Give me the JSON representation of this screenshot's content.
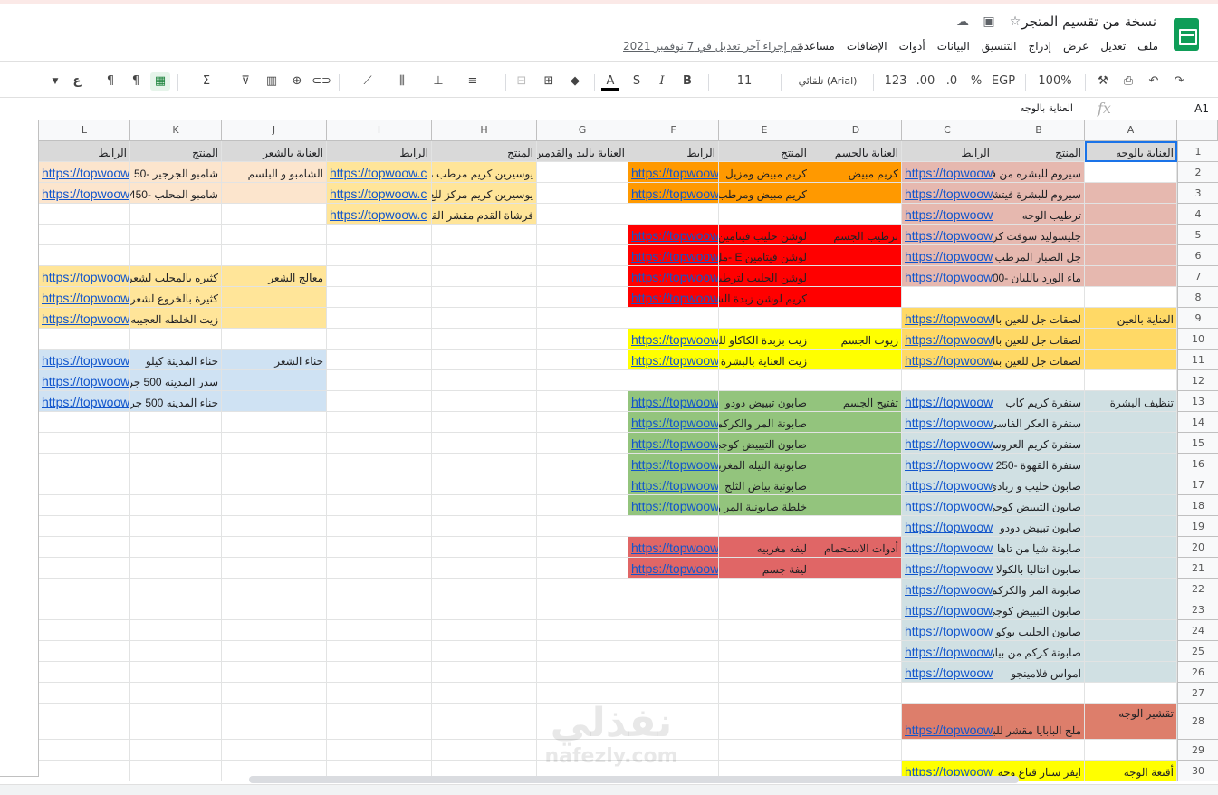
{
  "document": {
    "title": "نسخة من تقسيم المتجر",
    "last_edit": "تم إجراء آخر تعديل في 7 نوفمبر 2021"
  },
  "menu": [
    "ملف",
    "تعديل",
    "عرض",
    "إدراج",
    "التنسيق",
    "البيانات",
    "أدوات",
    "الإضافات",
    "مساعدة"
  ],
  "toolbar": {
    "zoom": "100%",
    "currency": "EGP",
    "percent": "%",
    "dec_decrease": ".0",
    "dec_increase": ".00",
    "format_123": "123",
    "font": "تلقائي (Arial)",
    "font_size": "11",
    "bold": "B",
    "italic": "I",
    "strike": "S",
    "text_color": "A"
  },
  "formula_bar": {
    "name_box": "A1",
    "fx": "fx",
    "value": "العناية بالوجه"
  },
  "columns": [
    "A",
    "B",
    "C",
    "D",
    "E",
    "F",
    "G",
    "H",
    "I",
    "J",
    "K",
    "L"
  ],
  "rows": [
    "1",
    "2",
    "3",
    "4",
    "5",
    "6",
    "7",
    "8",
    "9",
    "10",
    "11",
    "12",
    "13",
    "14",
    "15",
    "16",
    "17",
    "18",
    "19",
    "20",
    "21",
    "22",
    "23",
    "24",
    "25",
    "26",
    "27",
    "28",
    "29",
    "30"
  ],
  "colors": {
    "pink": "#e6b8af",
    "orange": "#ff9900",
    "red": "#ff0000",
    "lightorange": "#fce5cd",
    "yellowlight": "#ffe599",
    "yellow": "#ffff00",
    "blue": "#cfe2f3",
    "green": "#93c47d",
    "teal": "#d0e0e3",
    "salmon": "#e06666",
    "darksalmon": "#dd7e6b",
    "gold": "#ffd966",
    "header": "#d9d9d9",
    "selected": "#e8f0fe"
  },
  "link_text": "https://topwoow",
  "cells": [
    {
      "r": 1,
      "c": "A",
      "v": "العناية بالوجه",
      "bg": "#d9d9d9"
    },
    {
      "r": 1,
      "c": "B",
      "v": "المنتج",
      "bg": "#d9d9d9"
    },
    {
      "r": 1,
      "c": "C",
      "v": "الرابط",
      "bg": "#d9d9d9"
    },
    {
      "r": 1,
      "c": "D",
      "v": "العناية بالجسم",
      "bg": "#d9d9d9"
    },
    {
      "r": 1,
      "c": "E",
      "v": "المنتج",
      "bg": "#d9d9d9"
    },
    {
      "r": 1,
      "c": "F",
      "v": "الرابط",
      "bg": "#d9d9d9"
    },
    {
      "r": 1,
      "c": "G",
      "v": "العناية باليد والقدمين",
      "bg": "#d9d9d9"
    },
    {
      "r": 1,
      "c": "H",
      "v": "المنتج",
      "bg": "#d9d9d9"
    },
    {
      "r": 1,
      "c": "I",
      "v": "الرابط",
      "bg": "#d9d9d9"
    },
    {
      "r": 1,
      "c": "J",
      "v": "العناية بالشعر",
      "bg": "#d9d9d9"
    },
    {
      "r": 1,
      "c": "K",
      "v": "المنتج",
      "bg": "#d9d9d9"
    },
    {
      "r": 1,
      "c": "L",
      "v": "الرابط",
      "bg": "#d9d9d9"
    },
    {
      "r": 2,
      "c": "A",
      "v": "",
      "bg": "#ffffff"
    },
    {
      "r": 2,
      "c": "B",
      "v": "سيروم للبشره من فيتا",
      "bg": "#e6b8af"
    },
    {
      "r": 2,
      "c": "C",
      "v": "https://topwoow",
      "bg": "#e6b8af",
      "link": true
    },
    {
      "r": 2,
      "c": "D",
      "v": "كريم مبيض",
      "bg": "#ff9900"
    },
    {
      "r": 2,
      "c": "E",
      "v": "كريم مبيض ومزيل",
      "bg": "#ff9900"
    },
    {
      "r": 2,
      "c": "F",
      "v": "https://topwoow",
      "bg": "#ff9900",
      "link": true
    },
    {
      "r": 2,
      "c": "H",
      "v": "يوسيرين كريم مرطب من",
      "bg": "#ffe599"
    },
    {
      "r": 2,
      "c": "I",
      "v": "https://topwoow.c",
      "bg": "#ffe599",
      "link": true
    },
    {
      "r": 2,
      "c": "J",
      "v": "الشامبو و البلسم",
      "bg": "#fce5cd"
    },
    {
      "r": 2,
      "c": "K",
      "v": "شامبو الجرجير -50",
      "bg": "#fce5cd"
    },
    {
      "r": 2,
      "c": "L",
      "v": "https://topwoow",
      "bg": "#fce5cd",
      "link": true
    },
    {
      "r": 3,
      "c": "A",
      "v": "",
      "bg": "#e6b8af"
    },
    {
      "r": 3,
      "c": "B",
      "v": "سيروم للبشرة فيتشي",
      "bg": "#e6b8af"
    },
    {
      "r": 3,
      "c": "C",
      "v": "https://topwoow",
      "bg": "#e6b8af",
      "link": true
    },
    {
      "r": 3,
      "c": "D",
      "v": "",
      "bg": "#ff9900"
    },
    {
      "r": 3,
      "c": "E",
      "v": "كريم مبيض ومرطب",
      "bg": "#ff9900"
    },
    {
      "r": 3,
      "c": "F",
      "v": "https://topwoow",
      "bg": "#ff9900",
      "link": true
    },
    {
      "r": 3,
      "c": "H",
      "v": "يوسيرين كريم مركز للع",
      "bg": "#ffe599"
    },
    {
      "r": 3,
      "c": "I",
      "v": "https://topwoow.c",
      "bg": "#ffe599",
      "link": true
    },
    {
      "r": 3,
      "c": "J",
      "v": "",
      "bg": "#fce5cd"
    },
    {
      "r": 3,
      "c": "K",
      "v": "شامبو المحلب -450",
      "bg": "#fce5cd"
    },
    {
      "r": 3,
      "c": "L",
      "v": "https://topwoow",
      "bg": "#fce5cd",
      "link": true
    },
    {
      "r": 4,
      "c": "A",
      "v": "",
      "bg": "#e6b8af"
    },
    {
      "r": 4,
      "c": "B",
      "v": "ترطيب الوجه",
      "bg": "#e6b8af"
    },
    {
      "r": 4,
      "c": "C",
      "v": "https://topwoow",
      "bg": "#e6b8af",
      "link": true
    },
    {
      "r": 4,
      "c": "H",
      "v": "فرشاة القدم مقشر القدم",
      "bg": "#ffe599"
    },
    {
      "r": 4,
      "c": "I",
      "v": "https://topwoow.c",
      "bg": "#ffe599",
      "link": true
    },
    {
      "r": 5,
      "c": "A",
      "v": "",
      "bg": "#e6b8af"
    },
    {
      "r": 5,
      "c": "B",
      "v": "جليسوليد سوفت كريم",
      "bg": "#e6b8af"
    },
    {
      "r": 5,
      "c": "C",
      "v": "https://topwoow",
      "bg": "#e6b8af",
      "link": true
    },
    {
      "r": 5,
      "c": "D",
      "v": "ترطيب الجسم",
      "bg": "#ff0000"
    },
    {
      "r": 5,
      "c": "E",
      "v": "لوشن حليب فيتامين",
      "bg": "#ff0000"
    },
    {
      "r": 5,
      "c": "F",
      "v": "https://topwoow",
      "bg": "#ff0000",
      "link": true
    },
    {
      "r": 6,
      "c": "A",
      "v": "",
      "bg": "#e6b8af"
    },
    {
      "r": 6,
      "c": "B",
      "v": "جل الصبار المرطب",
      "bg": "#e6b8af"
    },
    {
      "r": 6,
      "c": "C",
      "v": "https://topwoow",
      "bg": "#e6b8af",
      "link": true
    },
    {
      "r": 6,
      "c": "D",
      "v": "",
      "bg": "#ff0000"
    },
    {
      "r": 6,
      "c": "E",
      "v": "لوشن فيتامين E -مل",
      "bg": "#ff0000"
    },
    {
      "r": 6,
      "c": "F",
      "v": "https://topwoow",
      "bg": "#ff0000",
      "link": true
    },
    {
      "r": 7,
      "c": "A",
      "v": "",
      "bg": "#e6b8af"
    },
    {
      "r": 7,
      "c": "B",
      "v": "ماء الورد باللبان -00",
      "bg": "#e6b8af"
    },
    {
      "r": 7,
      "c": "C",
      "v": "https://topwoow",
      "bg": "#e6b8af",
      "link": true
    },
    {
      "r": 7,
      "c": "D",
      "v": "",
      "bg": "#ff0000"
    },
    {
      "r": 7,
      "c": "E",
      "v": "لوشن الحليب لترطيب",
      "bg": "#ff0000"
    },
    {
      "r": 7,
      "c": "F",
      "v": "https://topwoow",
      "bg": "#ff0000",
      "link": true
    },
    {
      "r": 7,
      "c": "J",
      "v": "معالج الشعر",
      "bg": "#ffe599"
    },
    {
      "r": 7,
      "c": "K",
      "v": "كثيره بالمحلب لشعر",
      "bg": "#ffe599"
    },
    {
      "r": 7,
      "c": "L",
      "v": "https://topwoow",
      "bg": "#ffe599",
      "link": true
    },
    {
      "r": 8,
      "c": "D",
      "v": "",
      "bg": "#ff0000"
    },
    {
      "r": 8,
      "c": "E",
      "v": "كريم لوشن زبدة الشيا",
      "bg": "#ff0000"
    },
    {
      "r": 8,
      "c": "F",
      "v": "https://topwoow",
      "bg": "#ff0000",
      "link": true
    },
    {
      "r": 8,
      "c": "J",
      "v": "",
      "bg": "#ffe599"
    },
    {
      "r": 8,
      "c": "K",
      "v": "كثيرة بالخروع لشعر",
      "bg": "#ffe599"
    },
    {
      "r": 8,
      "c": "L",
      "v": "https://topwoow",
      "bg": "#ffe599",
      "link": true
    },
    {
      "r": 9,
      "c": "A",
      "v": "العناية بالعين",
      "bg": "#ffd966"
    },
    {
      "r": 9,
      "c": "B",
      "v": "لصقات جل للعين بال",
      "bg": "#ffd966"
    },
    {
      "r": 9,
      "c": "C",
      "v": "https://topwoow",
      "bg": "#ffd966",
      "link": true
    },
    {
      "r": 9,
      "c": "J",
      "v": "",
      "bg": "#ffe599"
    },
    {
      "r": 9,
      "c": "K",
      "v": "زيت الخلطه العجيبه",
      "bg": "#ffe599"
    },
    {
      "r": 9,
      "c": "L",
      "v": "https://topwoow",
      "bg": "#ffe599",
      "link": true
    },
    {
      "r": 10,
      "c": "A",
      "v": "",
      "bg": "#ffd966"
    },
    {
      "r": 10,
      "c": "B",
      "v": "لصقات جل للعين بال",
      "bg": "#ffd966"
    },
    {
      "r": 10,
      "c": "C",
      "v": "https://topwoow",
      "bg": "#ffd966",
      "link": true
    },
    {
      "r": 10,
      "c": "D",
      "v": "زيوت الجسم",
      "bg": "#ffff00"
    },
    {
      "r": 10,
      "c": "E",
      "v": "زيت بزبدة الكاكاو للج",
      "bg": "#ffff00"
    },
    {
      "r": 10,
      "c": "F",
      "v": "https://topwoow",
      "bg": "#ffff00",
      "link": true
    },
    {
      "r": 11,
      "c": "A",
      "v": "",
      "bg": "#ffd966"
    },
    {
      "r": 11,
      "c": "B",
      "v": "لصقات جل للعين بش",
      "bg": "#ffd966"
    },
    {
      "r": 11,
      "c": "C",
      "v": "https://topwoow",
      "bg": "#ffd966",
      "link": true
    },
    {
      "r": 11,
      "c": "D",
      "v": "",
      "bg": "#ffff00"
    },
    {
      "r": 11,
      "c": "E",
      "v": "زيت العناية بالبشرة",
      "bg": "#ffff00"
    },
    {
      "r": 11,
      "c": "F",
      "v": "https://topwoow",
      "bg": "#ffff00",
      "link": true
    },
    {
      "r": 11,
      "c": "J",
      "v": "حناء الشعر",
      "bg": "#cfe2f3"
    },
    {
      "r": 11,
      "c": "K",
      "v": "حناء المدينة كيلو",
      "bg": "#cfe2f3"
    },
    {
      "r": 11,
      "c": "L",
      "v": "https://topwoow",
      "bg": "#cfe2f3",
      "link": true
    },
    {
      "r": 12,
      "c": "J",
      "v": "",
      "bg": "#cfe2f3"
    },
    {
      "r": 12,
      "c": "K",
      "v": "سدر المدينه 500 جر",
      "bg": "#cfe2f3"
    },
    {
      "r": 12,
      "c": "L",
      "v": "https://topwoow",
      "bg": "#cfe2f3",
      "link": true
    },
    {
      "r": 13,
      "c": "A",
      "v": "تنظيف البشرة",
      "bg": "#d0e0e3"
    },
    {
      "r": 13,
      "c": "B",
      "v": "سنفرة كريم كاب",
      "bg": "#d0e0e3"
    },
    {
      "r": 13,
      "c": "C",
      "v": "https://topwoow",
      "bg": "#d0e0e3",
      "link": true
    },
    {
      "r": 13,
      "c": "D",
      "v": "تفتيح الجسم",
      "bg": "#93c47d"
    },
    {
      "r": 13,
      "c": "E",
      "v": "صابون تبييض دودو",
      "bg": "#93c47d"
    },
    {
      "r": 13,
      "c": "F",
      "v": "https://topwoow",
      "bg": "#93c47d",
      "link": true
    },
    {
      "r": 13,
      "c": "J",
      "v": "",
      "bg": "#cfe2f3"
    },
    {
      "r": 13,
      "c": "K",
      "v": "حناء المدينه 500 جر",
      "bg": "#cfe2f3"
    },
    {
      "r": 13,
      "c": "L",
      "v": "https://topwoow",
      "bg": "#cfe2f3",
      "link": true
    },
    {
      "r": 14,
      "c": "A",
      "v": "",
      "bg": "#d0e0e3"
    },
    {
      "r": 14,
      "c": "B",
      "v": "سنفرة العكر الفاسي",
      "bg": "#d0e0e3"
    },
    {
      "r": 14,
      "c": "C",
      "v": "https://topwoow",
      "bg": "#d0e0e3",
      "link": true
    },
    {
      "r": 14,
      "c": "D",
      "v": "",
      "bg": "#93c47d"
    },
    {
      "r": 14,
      "c": "E",
      "v": "صابونة المر والكركم",
      "bg": "#93c47d"
    },
    {
      "r": 14,
      "c": "F",
      "v": "https://topwoow",
      "bg": "#93c47d",
      "link": true
    },
    {
      "r": 15,
      "c": "A",
      "v": "",
      "bg": "#d0e0e3"
    },
    {
      "r": 15,
      "c": "B",
      "v": "سنفرة كريم العروسه",
      "bg": "#d0e0e3"
    },
    {
      "r": 15,
      "c": "C",
      "v": "https://topwoow",
      "bg": "#d0e0e3",
      "link": true
    },
    {
      "r": 15,
      "c": "D",
      "v": "",
      "bg": "#93c47d"
    },
    {
      "r": 15,
      "c": "E",
      "v": "صابون التبييض كوجي",
      "bg": "#93c47d"
    },
    {
      "r": 15,
      "c": "F",
      "v": "https://topwoow",
      "bg": "#93c47d",
      "link": true
    },
    {
      "r": 16,
      "c": "A",
      "v": "",
      "bg": "#d0e0e3"
    },
    {
      "r": 16,
      "c": "B",
      "v": "سنفرة القهوة -250",
      "bg": "#d0e0e3"
    },
    {
      "r": 16,
      "c": "C",
      "v": "https://topwoow",
      "bg": "#d0e0e3",
      "link": true
    },
    {
      "r": 16,
      "c": "D",
      "v": "",
      "bg": "#93c47d"
    },
    {
      "r": 16,
      "c": "E",
      "v": "صابونية النيله المغربي",
      "bg": "#93c47d"
    },
    {
      "r": 16,
      "c": "F",
      "v": "https://topwoow",
      "bg": "#93c47d",
      "link": true
    },
    {
      "r": 17,
      "c": "A",
      "v": "",
      "bg": "#d0e0e3"
    },
    {
      "r": 17,
      "c": "B",
      "v": "صابون حليب و زبادي",
      "bg": "#d0e0e3"
    },
    {
      "r": 17,
      "c": "C",
      "v": "https://topwoow",
      "bg": "#d0e0e3",
      "link": true
    },
    {
      "r": 17,
      "c": "D",
      "v": "",
      "bg": "#93c47d"
    },
    {
      "r": 17,
      "c": "E",
      "v": "صابونية بياض الثلج",
      "bg": "#93c47d"
    },
    {
      "r": 17,
      "c": "F",
      "v": "https://topwoow",
      "bg": "#93c47d",
      "link": true
    },
    {
      "r": 18,
      "c": "A",
      "v": "",
      "bg": "#d0e0e3"
    },
    {
      "r": 18,
      "c": "B",
      "v": "صابون التبييض كوجي",
      "bg": "#d0e0e3"
    },
    {
      "r": 18,
      "c": "C",
      "v": "https://topwoow",
      "bg": "#d0e0e3",
      "link": true
    },
    {
      "r": 18,
      "c": "D",
      "v": "",
      "bg": "#93c47d"
    },
    {
      "r": 18,
      "c": "E",
      "v": "خلطة صابونية المر و",
      "bg": "#93c47d"
    },
    {
      "r": 18,
      "c": "F",
      "v": "https://topwoow",
      "bg": "#93c47d",
      "link": true
    },
    {
      "r": 19,
      "c": "A",
      "v": "",
      "bg": "#d0e0e3"
    },
    {
      "r": 19,
      "c": "B",
      "v": "صابون تبييض دودو",
      "bg": "#d0e0e3"
    },
    {
      "r": 19,
      "c": "C",
      "v": "https://topwoow",
      "bg": "#d0e0e3",
      "link": true
    },
    {
      "r": 20,
      "c": "A",
      "v": "",
      "bg": "#d0e0e3"
    },
    {
      "r": 20,
      "c": "B",
      "v": "صابونة شيا من تاها",
      "bg": "#d0e0e3"
    },
    {
      "r": 20,
      "c": "C",
      "v": "https://topwoow",
      "bg": "#d0e0e3",
      "link": true
    },
    {
      "r": 20,
      "c": "D",
      "v": "أدوات الاستحمام",
      "bg": "#e06666"
    },
    {
      "r": 20,
      "c": "E",
      "v": "ليفه مغربيه",
      "bg": "#e06666"
    },
    {
      "r": 20,
      "c": "F",
      "v": "https://topwoow",
      "bg": "#e06666",
      "link": true
    },
    {
      "r": 21,
      "c": "A",
      "v": "",
      "bg": "#d0e0e3"
    },
    {
      "r": 21,
      "c": "B",
      "v": "صابون انتاليا بالكولا",
      "bg": "#d0e0e3"
    },
    {
      "r": 21,
      "c": "C",
      "v": "https://topwoow",
      "bg": "#d0e0e3",
      "link": true
    },
    {
      "r": 21,
      "c": "D",
      "v": "",
      "bg": "#e06666"
    },
    {
      "r": 21,
      "c": "E",
      "v": "ليفة جسم",
      "bg": "#e06666"
    },
    {
      "r": 21,
      "c": "F",
      "v": "https://topwoow",
      "bg": "#e06666",
      "link": true
    },
    {
      "r": 22,
      "c": "A",
      "v": "",
      "bg": "#d0e0e3"
    },
    {
      "r": 22,
      "c": "B",
      "v": "صابونة المر والكركم",
      "bg": "#d0e0e3"
    },
    {
      "r": 22,
      "c": "C",
      "v": "https://topwoow",
      "bg": "#d0e0e3",
      "link": true
    },
    {
      "r": 23,
      "c": "A",
      "v": "",
      "bg": "#d0e0e3"
    },
    {
      "r": 23,
      "c": "B",
      "v": "صابون التبييض كوجي",
      "bg": "#d0e0e3"
    },
    {
      "r": 23,
      "c": "C",
      "v": "https://topwoow",
      "bg": "#d0e0e3",
      "link": true
    },
    {
      "r": 24,
      "c": "A",
      "v": "",
      "bg": "#d0e0e3"
    },
    {
      "r": 24,
      "c": "B",
      "v": "صابون الحليب بوكو",
      "bg": "#d0e0e3"
    },
    {
      "r": 24,
      "c": "C",
      "v": "https://topwoow",
      "bg": "#d0e0e3",
      "link": true
    },
    {
      "r": 25,
      "c": "A",
      "v": "",
      "bg": "#d0e0e3"
    },
    {
      "r": 25,
      "c": "B",
      "v": "صابونة كركم من بيار",
      "bg": "#d0e0e3"
    },
    {
      "r": 25,
      "c": "C",
      "v": "https://topwoow",
      "bg": "#d0e0e3",
      "link": true
    },
    {
      "r": 26,
      "c": "A",
      "v": "",
      "bg": "#d0e0e3"
    },
    {
      "r": 26,
      "c": "B",
      "v": "امواس فلامينجو",
      "bg": "#d0e0e3"
    },
    {
      "r": 26,
      "c": "C",
      "v": "https://topwoow",
      "bg": "#d0e0e3",
      "link": true
    },
    {
      "r": 28,
      "c": "A",
      "v": "تقشير الوجه",
      "bg": "#dd7e6b",
      "top": true
    },
    {
      "r": 28,
      "c": "B",
      "v": "ملح البابايا مقشر للبش",
      "bg": "#dd7e6b"
    },
    {
      "r": 28,
      "c": "C",
      "v": "https://topwoow",
      "bg": "#dd7e6b",
      "link": true
    },
    {
      "r": 30,
      "c": "A",
      "v": "أقنعة الوجه",
      "bg": "#ffff00"
    },
    {
      "r": 30,
      "c": "B",
      "v": "ايفر ستار قناع وجه",
      "bg": "#ffff00"
    },
    {
      "r": 30,
      "c": "C",
      "v": "https://topwoow",
      "bg": "#ffff00",
      "link": true
    }
  ]
}
